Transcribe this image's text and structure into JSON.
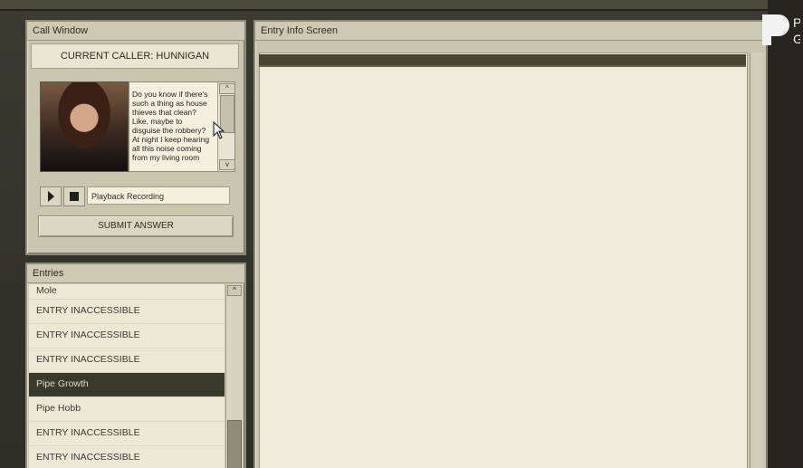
{
  "call_window": {
    "title": "Call Window",
    "current_caller": "CURRENT CALLER: HUNNIGAN",
    "transcript": "Do you know if there's such a thing as house thieves that clean? Like, maybe to disguise the robbery? At night I keep hearing all this noise coming from my living room",
    "scroll_up": "^",
    "scroll_down": "v",
    "playback_label": "Playback Recording",
    "submit_label": "SUBMIT ANSWER"
  },
  "entries": {
    "title": "Entries",
    "scroll_up": "^",
    "items": [
      {
        "label": "Mole",
        "selected": false
      },
      {
        "label": "ENTRY INACCESSIBLE",
        "selected": false
      },
      {
        "label": "ENTRY INACCESSIBLE",
        "selected": false
      },
      {
        "label": "ENTRY INACCESSIBLE",
        "selected": false
      },
      {
        "label": "Pipe Growth",
        "selected": true
      },
      {
        "label": "Pipe Hobb",
        "selected": false
      },
      {
        "label": "ENTRY INACCESSIBLE",
        "selected": false
      },
      {
        "label": "ENTRY INACCESSIBLE",
        "selected": false
      }
    ]
  },
  "entry_info": {
    "title": "Entry Info Screen"
  },
  "colors": {
    "panel": "#c9c6b0",
    "selected_row": "#3a3a2c",
    "screen_bg": "#f0ecdb"
  }
}
